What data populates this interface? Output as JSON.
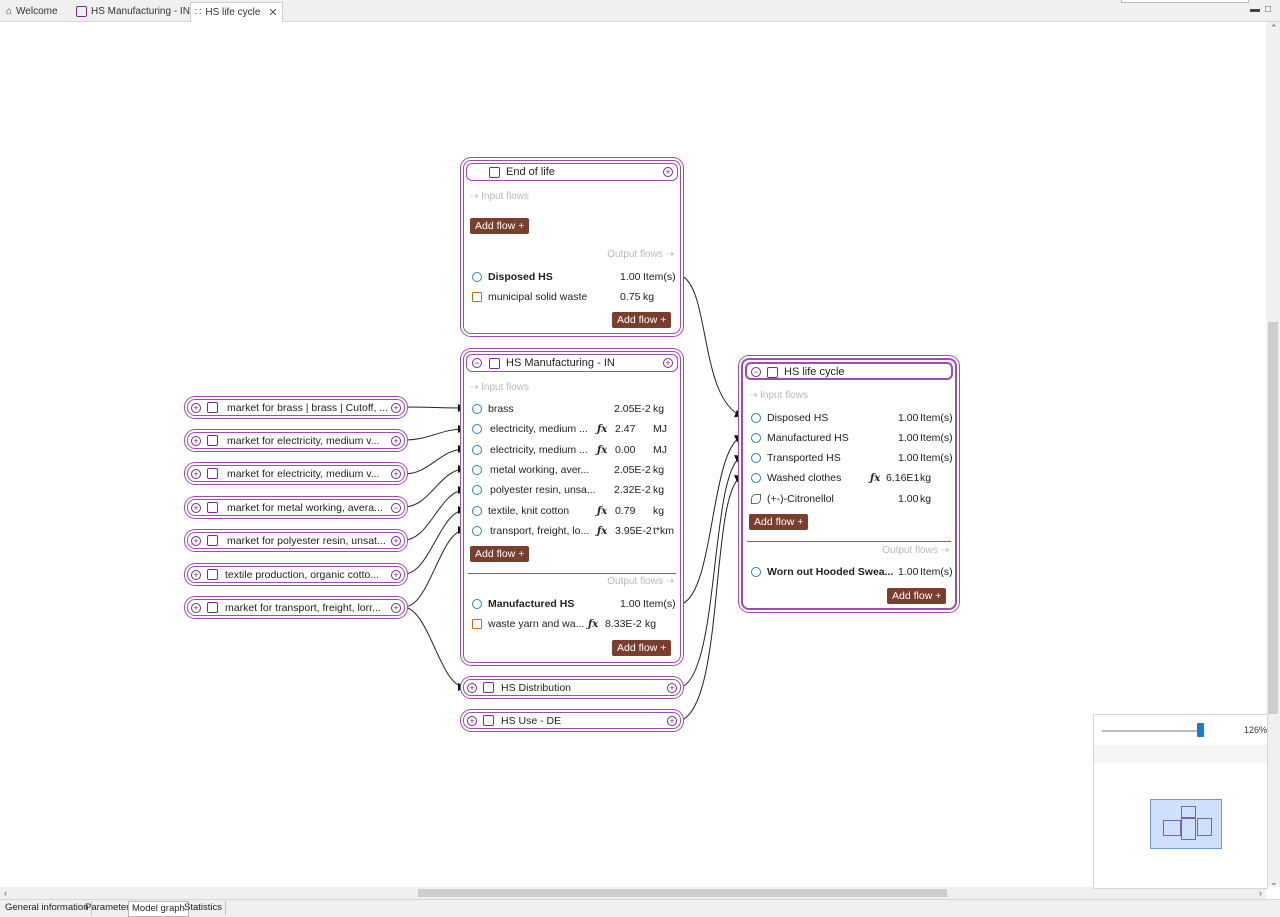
{
  "tabs": [
    {
      "label": "Welcome",
      "icon": "home-icon"
    },
    {
      "label": "HS Manufacturing - IN",
      "icon": "process-icon"
    },
    {
      "label": "HS life cycle",
      "icon": "model-graph-icon",
      "active": true
    }
  ],
  "end_of_life": {
    "title": "End of life",
    "input_label": "⇢ Input flows",
    "output_label": "Output flows ⇢",
    "add_flow": "Add flow +",
    "outputs": [
      {
        "name": "Disposed HS",
        "amount": "1.00",
        "unit": "Item(s)",
        "bold": true
      },
      {
        "name": "municipal solid waste",
        "amount": "0.75",
        "unit": "kg"
      }
    ]
  },
  "manufacturing": {
    "title": "HS Manufacturing - IN",
    "input_label": "⇢ Input flows",
    "output_label": "Output flows ⇢",
    "add_flow": "Add flow +",
    "inputs": [
      {
        "name": "brass",
        "amount": "2.05E-2",
        "unit": "kg"
      },
      {
        "name": "electricity, medium ...",
        "fx": "fx",
        "amount": "2.47",
        "unit": "MJ"
      },
      {
        "name": "electricity, medium ...",
        "fx": "fx",
        "amount": "0.00",
        "unit": "MJ"
      },
      {
        "name": "metal working, aver...",
        "amount": "2.05E-2",
        "unit": "kg"
      },
      {
        "name": "polyester resin, unsa...",
        "amount": "2.32E-2",
        "unit": "kg"
      },
      {
        "name": "textile, knit cotton",
        "fx": "fx",
        "amount": "0.79",
        "unit": "kg"
      },
      {
        "name": "transport, freight, lo...",
        "fx": "fx",
        "amount": "3.95E-2",
        "unit": "t*km"
      }
    ],
    "outputs": [
      {
        "name": "Manufactured HS",
        "amount": "1.00",
        "unit": "Item(s)",
        "bold": true
      },
      {
        "name": "waste yarn and wa...",
        "fx": "fx",
        "amount": "8.33E-2",
        "unit": "kg"
      }
    ]
  },
  "life_cycle": {
    "title": "HS life cycle",
    "input_label": "⇢ Input flows",
    "output_label": "Output flows ⇢",
    "add_flow": "Add flow +",
    "inputs": [
      {
        "name": "Disposed HS",
        "amount": "1.00",
        "unit": "Item(s)"
      },
      {
        "name": "Manufactured HS",
        "amount": "1.00",
        "unit": "Item(s)"
      },
      {
        "name": "Transported HS",
        "amount": "1.00",
        "unit": "Item(s)"
      },
      {
        "name": "Washed clothes",
        "fx": "fx",
        "amount": "6.16E1",
        "unit": "kg"
      },
      {
        "name": "(+-)-Citronellol",
        "amount": "1.00",
        "unit": "kg"
      }
    ],
    "outputs": [
      {
        "name": "Worn out Hooded Swea...",
        "amount": "1.00",
        "unit": "Item(s)",
        "bold": true
      }
    ]
  },
  "providers": [
    "market for brass | brass | Cutoff, ...",
    "market for electricity, medium v...",
    "market for electricity, medium v...",
    "market for metal working, avera...",
    "market for polyester resin, unsat...",
    "textile production, organic cotto...",
    "market for transport, freight, lorr..."
  ],
  "collapsed_nodes": [
    {
      "title": "HS Distribution"
    },
    {
      "title": "HS Use - DE"
    }
  ],
  "zoom_label": "126%",
  "bottom_tabs": [
    "General information",
    "Parameters",
    "Model graph",
    "Statistics"
  ],
  "colors": {
    "node_border": "#a24ab4",
    "button": "#7a3e2e",
    "flow_icon": "#2e7fc6"
  }
}
